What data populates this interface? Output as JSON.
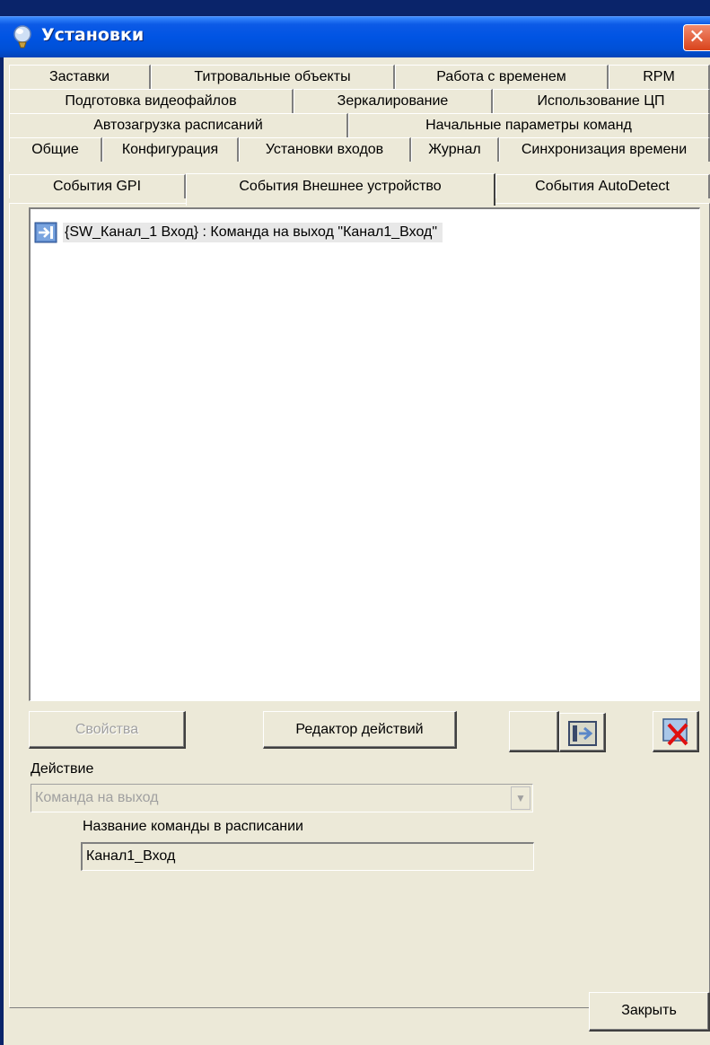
{
  "window": {
    "title": "Установки",
    "close_label": "✕"
  },
  "tabs": {
    "row1": [
      "Заставки",
      "Титровальные объекты",
      "Работа с временем",
      "RPM"
    ],
    "row2": [
      "Подготовка видеофайлов",
      "Зеркалирование",
      "Использование ЦП"
    ],
    "row3": [
      "Автозагрузка расписаний",
      "Начальные параметры команд"
    ],
    "row4": [
      "Общие",
      "Конфигурация",
      "Установки входов",
      "Журнал",
      "Синхронизация времени"
    ],
    "row5": [
      "События GPI",
      "События Внешнее устройство",
      "События AutoDetect"
    ],
    "active": "События Внешнее устройство"
  },
  "events_list": {
    "items": [
      {
        "icon": "output-command-icon",
        "text": "{SW_Канал_1 Вход} : Команда на выход \"Канал1_Вход\""
      }
    ]
  },
  "buttons": {
    "properties": "Свойства",
    "action_editor": "Редактор действий",
    "close": "Закрыть"
  },
  "action": {
    "label": "Действие",
    "value": "Команда на выход"
  },
  "command_name": {
    "label": "Название команды в расписании",
    "value": "Канал1_Вход"
  }
}
